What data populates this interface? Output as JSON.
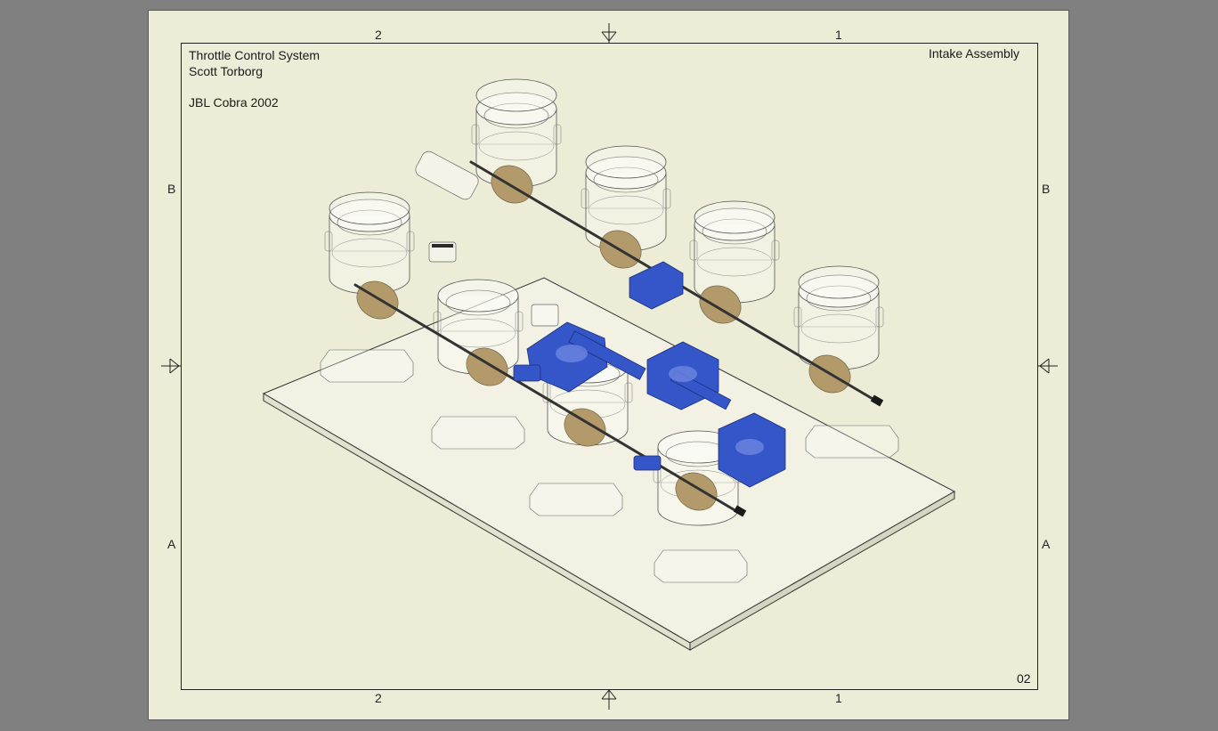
{
  "title_block": {
    "line1": "Throttle Control System",
    "line2": "Scott Torborg",
    "line3": "JBL Cobra 2002",
    "assembly_name": "Intake Assembly",
    "sheet_number": "02"
  },
  "zones": {
    "top_left": "2",
    "top_right": "1",
    "bottom_left": "2",
    "bottom_right": "1",
    "left_upper": "B",
    "left_lower": "A",
    "right_upper": "B",
    "right_lower": "A"
  },
  "colors": {
    "background": "#808080",
    "sheet": "#ECECD7",
    "blue_part": "#3556C8",
    "butterfly": "#B39A6B"
  }
}
